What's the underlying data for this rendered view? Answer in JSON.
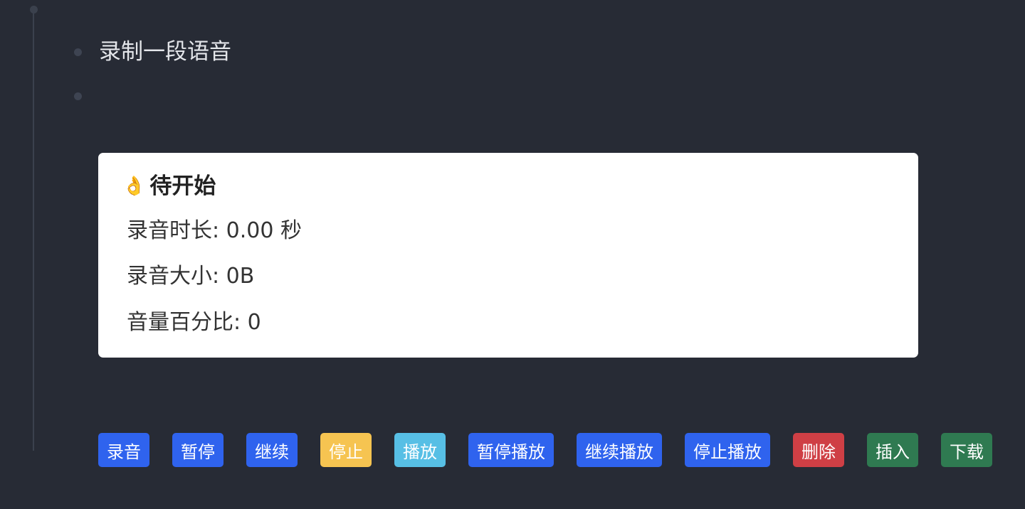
{
  "block": {
    "title": "录制一段语音"
  },
  "recorder": {
    "status_emoji": "👌",
    "status_text": "待开始",
    "duration_label": "录音时长:",
    "duration_value": "0.00 秒",
    "size_label": "录音大小:",
    "size_value": "0B",
    "volume_label": "音量百分比:",
    "volume_value": "0"
  },
  "buttons": {
    "record": "录音",
    "pause": "暂停",
    "resume": "继续",
    "stop": "停止",
    "play": "播放",
    "pause_play": "暂停播放",
    "resume_play": "继续播放",
    "stop_play": "停止播放",
    "delete": "删除",
    "insert": "插入",
    "download": "下载"
  },
  "colors": {
    "background": "#272b35",
    "primary": "#2f63ee",
    "warning": "#f6c451",
    "info": "#57bfe5",
    "danger": "#cf3f45",
    "success": "#2f7a51"
  }
}
